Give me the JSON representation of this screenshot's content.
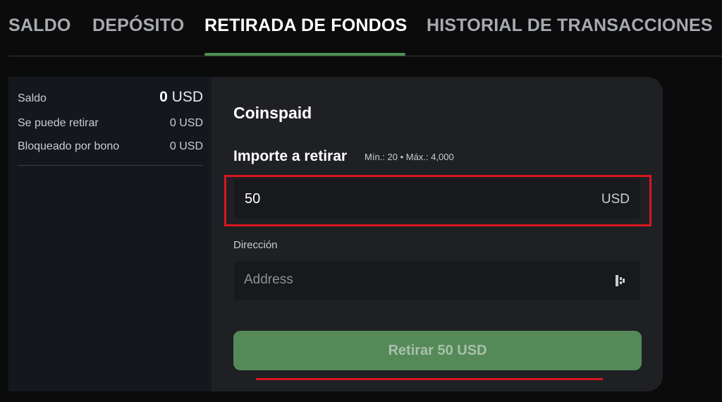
{
  "tabs": [
    {
      "label": "SALDO",
      "active": false
    },
    {
      "label": "DEPÓSITO",
      "active": false
    },
    {
      "label": "RETIRADA DE FONDOS",
      "active": true
    },
    {
      "label": "HISTORIAL DE TRANSACCIONES",
      "active": false
    }
  ],
  "balance": {
    "rows": [
      {
        "label": "Saldo",
        "amount": "0",
        "currency": "USD"
      },
      {
        "label": "Se puede retirar",
        "value": "0 USD"
      },
      {
        "label": "Bloqueado por bono",
        "value": "0 USD"
      }
    ]
  },
  "withdrawal": {
    "method": "Coinspaid",
    "amount_label": "Importe a retirar",
    "limits": "Mín.: 20 • Máx.: 4,000",
    "amount_value": "50",
    "amount_currency": "USD",
    "address_label": "Dirección",
    "address_placeholder": "Address",
    "address_value": "",
    "paste_icon": "paste-icon",
    "button_label": "Retirar 50 USD"
  },
  "colors": {
    "accent_green": "#558a58",
    "tab_underline": "#4e8f55",
    "highlight_red": "#d7171f"
  }
}
